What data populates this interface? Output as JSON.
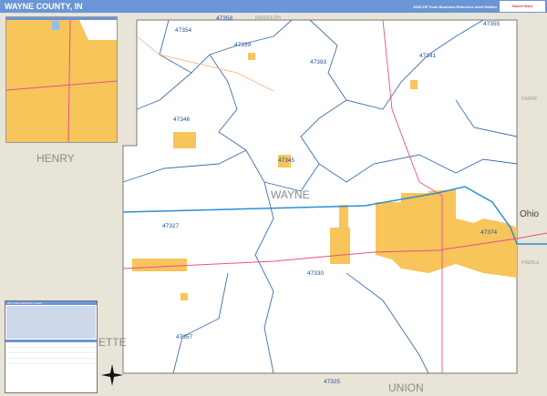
{
  "header": {
    "title": "WAYNE COUNTY, IN",
    "subtitle": "2026 ZIP Code Business Reference Inset Edition",
    "logo": "Market Maps"
  },
  "counties": {
    "main": "WAYNE",
    "west": "HENRY",
    "south": "UNION",
    "southwest": "ETTE",
    "north": "RANDOLPH",
    "east": "DARKE",
    "southeast": "PREBLE",
    "state_east": "Ohio"
  },
  "zip_codes": [
    "47358",
    "47354",
    "47339",
    "47355",
    "47393",
    "47341",
    "47346",
    "47345",
    "47327",
    "47374",
    "47330",
    "47357",
    "47325"
  ],
  "legend": {
    "title": "ZIP Code Index/Grid Locator"
  },
  "colors": {
    "header": "#6a95d6",
    "urban": "#f7c55a",
    "zip_boundary": "#3d6fb0",
    "county_bg": "#e9e4d8",
    "interstate": "#2a8fd6",
    "highway": "#e84f8a"
  }
}
